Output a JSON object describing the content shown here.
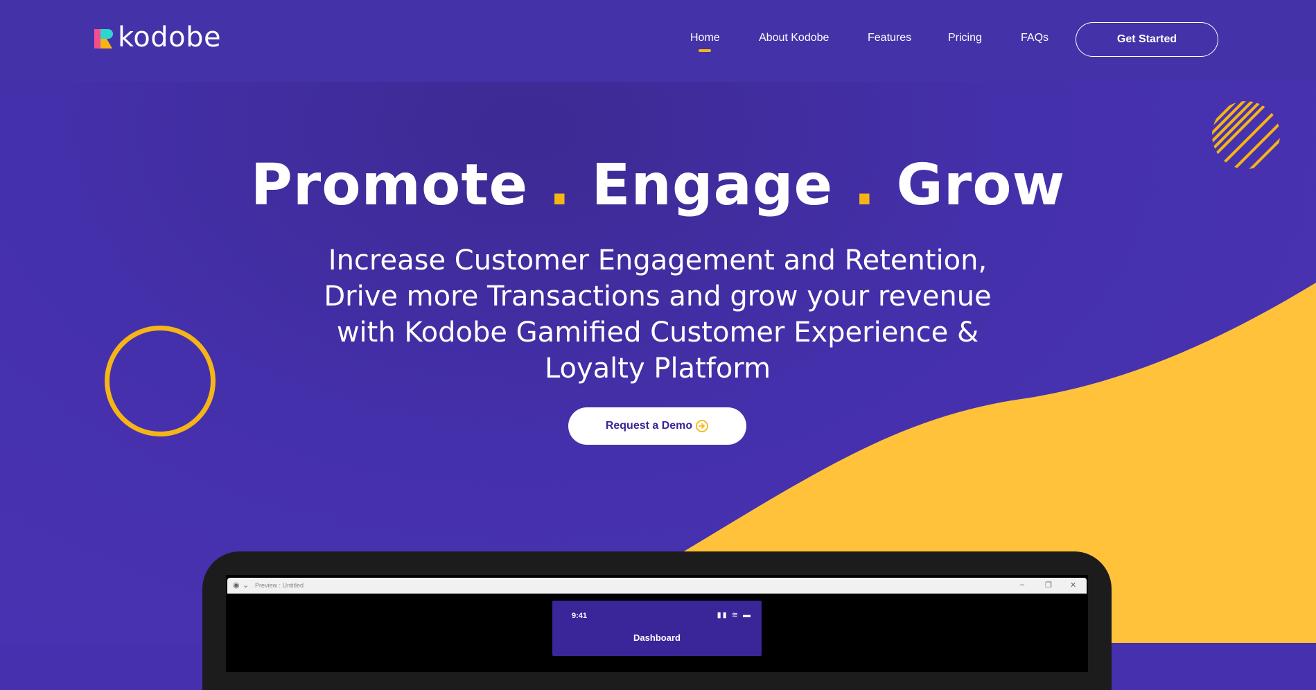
{
  "brand": {
    "name": "kodobe",
    "colors": {
      "primary_purple": "#4630ad",
      "accent_yellow": "#f5b516",
      "logo_pink": "#ef4f8d",
      "logo_teal": "#2fd6cf"
    }
  },
  "nav": {
    "items": [
      {
        "label": "Home",
        "active": true
      },
      {
        "label": "About Kodobe",
        "active": false
      },
      {
        "label": "Features",
        "active": false
      },
      {
        "label": "Pricing",
        "active": false
      },
      {
        "label": "FAQs",
        "active": false
      }
    ],
    "cta_label": "Get Started"
  },
  "hero": {
    "headline_words": [
      "Promote",
      "Engage",
      "Grow"
    ],
    "headline_separator": ".",
    "subheadline_lines": [
      "Increase Customer Engagement and Retention,",
      "Drive more Transactions and grow your revenue",
      "with Kodobe Gamified Customer Experience &",
      "Loyalty Platform"
    ],
    "demo_button_label": "Request a Demo",
    "demo_button_icon": "arrow-right-circle-icon"
  },
  "mockup": {
    "window_title": "Preview : Untitled",
    "phone": {
      "time": "9:41",
      "screen_title": "Dashboard"
    }
  }
}
